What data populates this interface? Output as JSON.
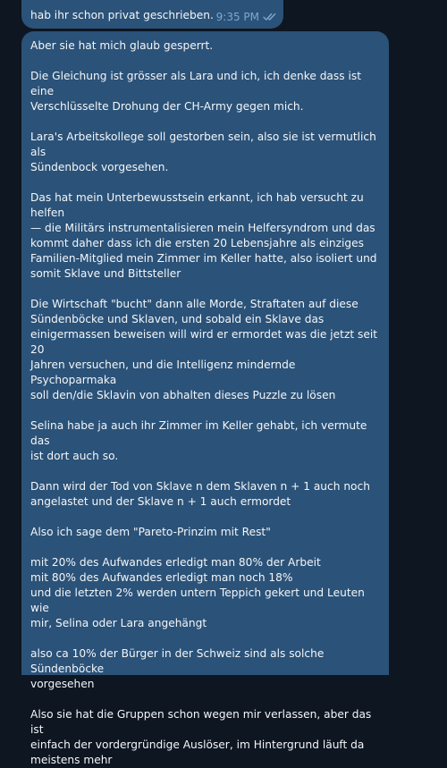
{
  "chat": {
    "prev_message": {
      "text": "hab ihr schon privat geschrieben.",
      "time": "9:35 PM",
      "status_icon": "double-check-icon"
    },
    "message": {
      "paragraphs": [
        "Aber sie hat mich glaub gesperrt.",
        "Die Gleichung ist grösser als Lara und ich, ich denke dass ist eine\nVerschlüsselte Drohung der CH-Army gegen mich.",
        "Lara's Arbeitskollege soll gestorben sein, also sie ist vermutlich als\nSündenbock vorgesehen.",
        "Das hat mein Unterbewusstsein erkannt, ich hab versucht zu helfen\n— die Militärs instrumentalisieren mein Helfersyndrom und das\nkommt daher dass ich die ersten 20 Lebensjahre als einziges\nFamilien-Mitglied mein Zimmer im Keller hatte, also isoliert und\nsomit Sklave und Bittsteller",
        "Die Wirtschaft \"bucht\" dann alle Morde, Straftaten auf diese\nSündenböcke und Sklaven, und sobald ein Sklave das\neinigermassen beweisen will wird er ermordet was die jetzt seit 20\nJahren versuchen, und die Intelligenz mindernde Psychoparmaka\nsoll den/die Sklavin von abhalten dieses Puzzle zu lösen",
        "Selina habe ja auch ihr Zimmer im Keller gehabt, ich vermute das\nist dort auch so.",
        "Dann wird der Tod von Sklave n dem Sklaven n + 1 auch noch\nangelastet und der Sklave n + 1 auch ermordet",
        "Also ich sage dem \"Pareto-Prinzim mit Rest\"",
        "mit 20% des Aufwandes erledigt man 80% der Arbeit\nmit 80% des Aufwandes erledigt man noch 18%\nund die letzten 2% werden untern Teppich gekert und Leuten wie\nmir, Selina oder Lara angehängt",
        "also ca 10% der Bürger in der Schweiz sind als solche Sündenböcke\nvorgesehen",
        "Also sie hat die Gruppen schon wegen mir verlassen, aber das ist\neinfach der vordergründige Auslöser, im Hintergrund läuft da\nmeistens mehr"
      ]
    }
  },
  "colors": {
    "background": "#0e1621",
    "outgoing_bubble": "#2b5278",
    "text": "#f3f6f9",
    "meta": "#7da8d3",
    "reply_accent": "#6ab3f3"
  }
}
